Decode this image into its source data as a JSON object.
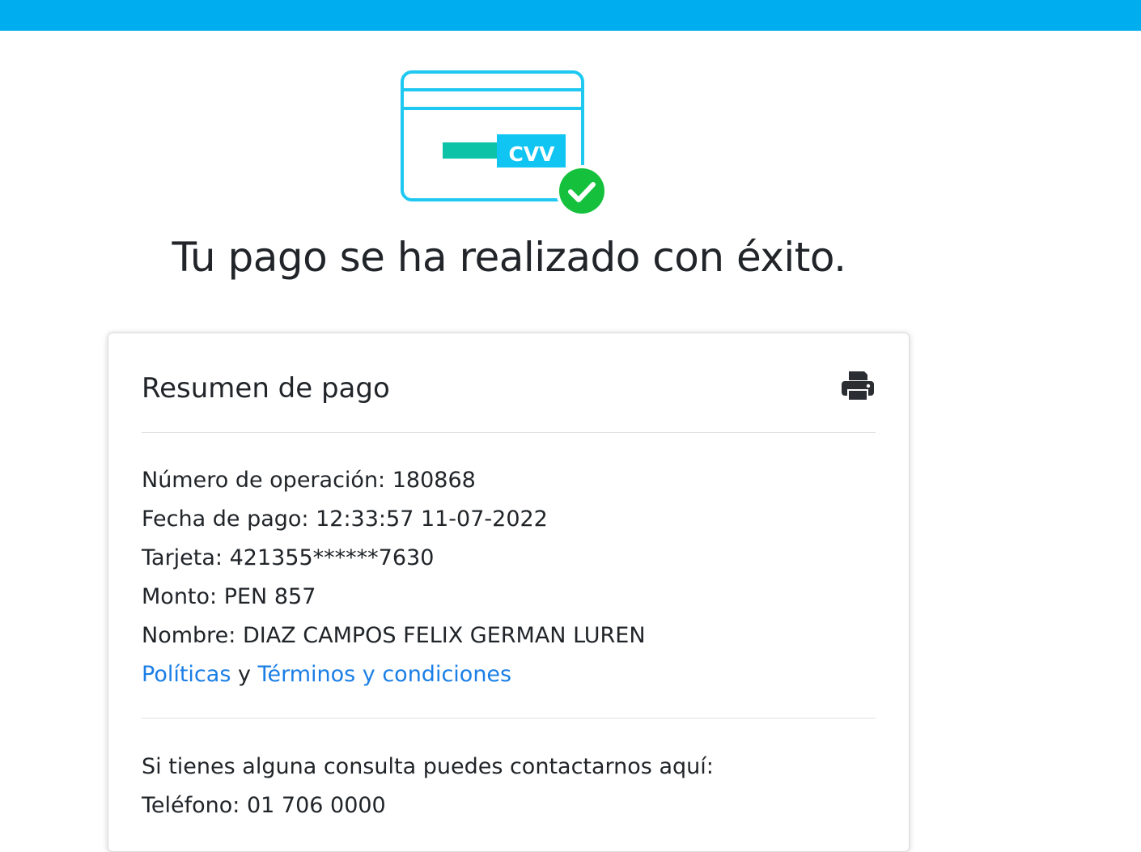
{
  "header": {
    "bar_color": "#00aeef"
  },
  "hero": {
    "icon": "credit-card-cvv-success-icon",
    "cvv_label": "CVV",
    "title": "Tu pago se ha realizado con éxito."
  },
  "summary": {
    "title": "Resumen de pago",
    "print_icon": "printer-icon",
    "operation": "Número de operación: 180868",
    "date": "Fecha de pago: 12:33:57 11-07-2022",
    "card": "Tarjeta: 421355******7630",
    "amount": "Monto: PEN 857",
    "name": "Nombre: DIAZ CAMPOS FELIX GERMAN LUREN",
    "links": {
      "policies": "Políticas",
      "conjunction": " y ",
      "terms": "Términos y condiciones"
    },
    "contact": {
      "intro": "Si tienes alguna consulta puedes contactarnos aquí:",
      "phone": "Teléfono: 01 706 0000"
    }
  },
  "colors": {
    "accent": "#00aeef",
    "card_outline": "#1ec8f0",
    "cvv_box": "#10c5f2",
    "cvv_bar": "#0cc3a8",
    "success": "#15c13c",
    "link": "#1a7ee6"
  }
}
